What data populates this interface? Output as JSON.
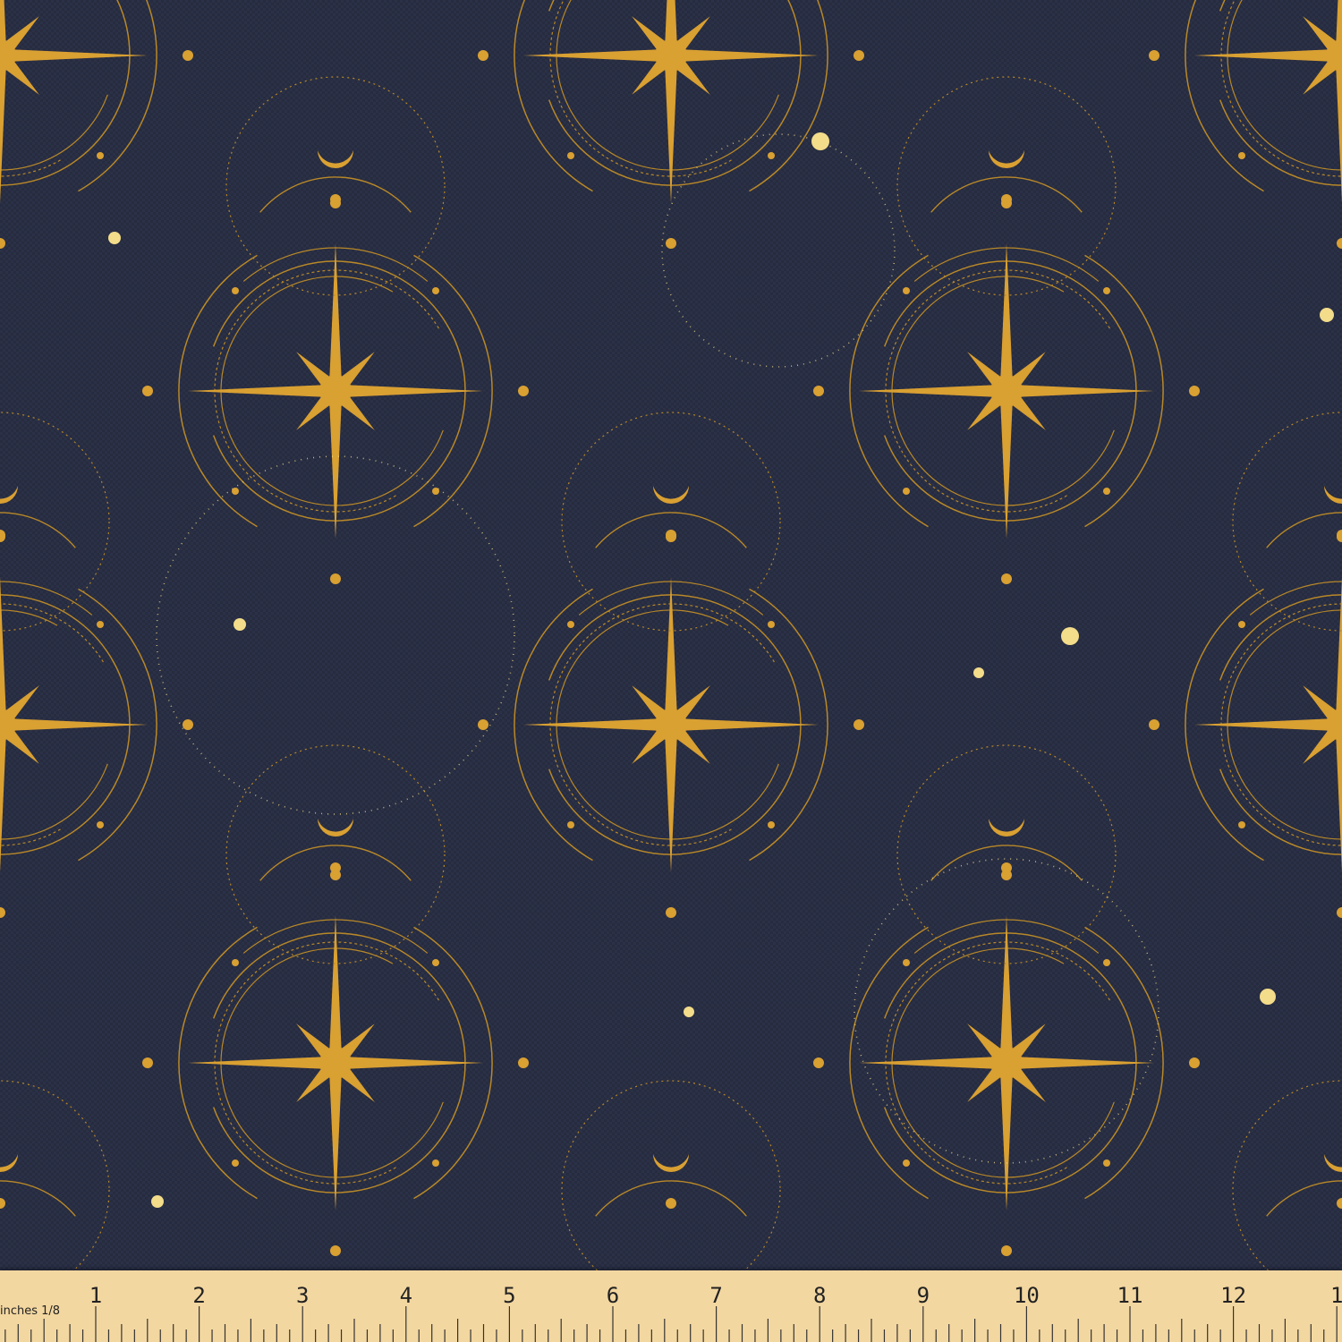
{
  "image": {
    "subject": "compass-star-fabric-swatch",
    "colors": {
      "background": "#2b3147",
      "background_weave": "#252a3d",
      "gold": "#d9a032",
      "gold_dark": "#b88828",
      "dot_light": "#f3dc8a",
      "ruler": "#f3d7a0"
    }
  },
  "ruler": {
    "unit_label": "inches 1/8",
    "numbers": [
      "1",
      "2",
      "3",
      "4",
      "5",
      "6",
      "7",
      "8",
      "9",
      "10",
      "11",
      "12",
      "1"
    ]
  }
}
